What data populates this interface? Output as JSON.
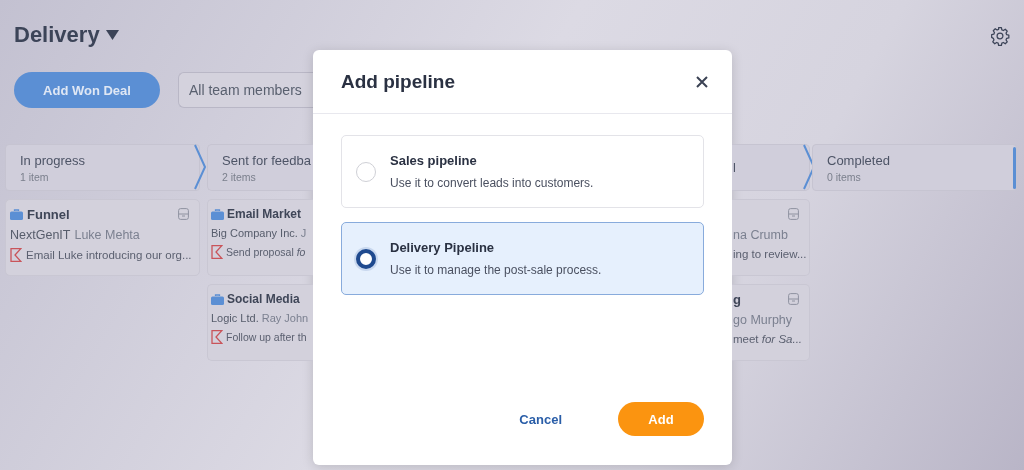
{
  "header": {
    "title": "Delivery"
  },
  "toolbar": {
    "add_button": "Add Won Deal",
    "filter": {
      "value": "All team members"
    }
  },
  "stages": [
    {
      "name": "In progress",
      "count": "1 item",
      "deals": [
        {
          "title": "Funnel",
          "company": "NextGenIT",
          "contact": "Luke Mehta",
          "task": "Email Luke introducing our org..."
        }
      ]
    },
    {
      "name": "Sent for feedba",
      "count": "2 items",
      "deals": [
        {
          "title": "Email Market",
          "company": "Big Company Inc.",
          "contact": "J",
          "task": "Send proposal *fo*"
        },
        {
          "title": "Social Media",
          "company": "Logic Ltd.",
          "contact": "Ray John",
          "task": "Follow up after th"
        }
      ]
    },
    {
      "name": "l",
      "deals": [
        {
          "contact": "na Crumb",
          "task": "ing to review..."
        },
        {
          "title": "g",
          "contact": "go Murphy",
          "task": "meet *for Sa...*"
        }
      ]
    },
    {
      "name": "Completed",
      "count": "0 items"
    }
  ],
  "modal": {
    "title": "Add pipeline",
    "options": [
      {
        "name": "Sales pipeline",
        "description": "Use it to convert leads into customers.",
        "selected": false
      },
      {
        "name": "Delivery Pipeline",
        "description": "Use it to manage the post-sale process.",
        "selected": true
      }
    ],
    "cancel": "Cancel",
    "add": "Add"
  }
}
